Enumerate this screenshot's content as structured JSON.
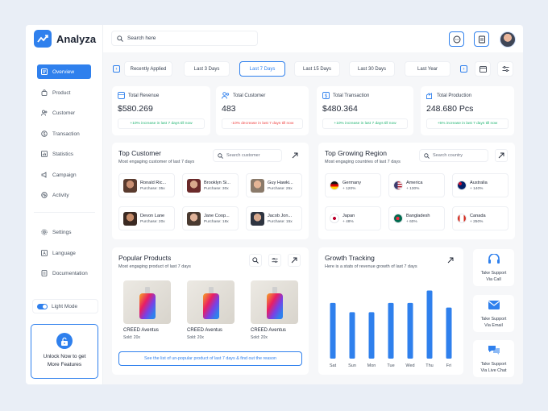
{
  "app": {
    "name": "Analyza"
  },
  "sidebar": {
    "items": [
      {
        "label": "Overview",
        "icon": "overview-icon"
      },
      {
        "label": "Product",
        "icon": "bag-icon"
      },
      {
        "label": "Customer",
        "icon": "users-icon"
      },
      {
        "label": "Transaction",
        "icon": "wallet-icon"
      },
      {
        "label": "Statistics",
        "icon": "chart-icon"
      },
      {
        "label": "Campaign",
        "icon": "megaphone-icon"
      },
      {
        "label": "Activity",
        "icon": "activity-icon"
      }
    ],
    "bottom_items": [
      {
        "label": "Settings",
        "icon": "gear-icon"
      },
      {
        "label": "Language",
        "icon": "language-icon"
      },
      {
        "label": "Documentation",
        "icon": "document-icon"
      }
    ],
    "light_mode": "Light Mode",
    "unlock": {
      "line1": "Unlock Now to get",
      "line2": "More Features"
    }
  },
  "header": {
    "search_placeholder": "Search here"
  },
  "filters": [
    "Recently Applied",
    "Last 3 Days",
    "Last 7 Days",
    "Last 15 Days",
    "Last 30 Days",
    "Last Year"
  ],
  "selected_filter": "Last 7 Days",
  "stats": [
    {
      "label": "Total Revenue",
      "value": "$580.269",
      "note": "+10% increase in last 7 days till now",
      "trend": "up"
    },
    {
      "label": "Total Customer",
      "value": "483",
      "note": "-10% decrease in last 7 days till now",
      "trend": "down"
    },
    {
      "label": "Total Transaction",
      "value": "$480.364",
      "note": "+10% increase in last 7 days till now",
      "trend": "up"
    },
    {
      "label": "Total Production",
      "value": "248.680 Pcs",
      "note": "+5% increase in last 7 days till now",
      "trend": "up"
    }
  ],
  "top_customer": {
    "title": "Top Customer",
    "subtitle": "Most engaging customer of last 7 days",
    "search_placeholder": "Search customer",
    "people": [
      {
        "name": "Ronald Ric...",
        "purchase": "Purchase: 35x"
      },
      {
        "name": "Brooklyn Si...",
        "purchase": "Purchase: 30x"
      },
      {
        "name": "Guy Hawki...",
        "purchase": "Purchase: 25x"
      },
      {
        "name": "Devon Lane",
        "purchase": "Purchase: 20x"
      },
      {
        "name": "Jane Coop...",
        "purchase": "Purchase: 18x"
      },
      {
        "name": "Jacob Jon...",
        "purchase": "Purchase: 15x"
      }
    ]
  },
  "top_region": {
    "title": "Top Growing Region",
    "subtitle": "Most engaging countries of last 7 days",
    "search_placeholder": "Search country",
    "countries": [
      {
        "name": "Germany",
        "growth": "+ 120%"
      },
      {
        "name": "America",
        "growth": "+ 130%"
      },
      {
        "name": "Australia",
        "growth": "+ 140%"
      },
      {
        "name": "Japan",
        "growth": "+ 48%"
      },
      {
        "name": "Bangladesh",
        "growth": "+ 60%"
      },
      {
        "name": "Canada",
        "growth": "+ 250%"
      }
    ]
  },
  "popular_products": {
    "title": "Popular Products",
    "subtitle": "Most engaging product of last 7 days",
    "items": [
      {
        "name": "CREED Aventus",
        "sold": "Sold: 20x"
      },
      {
        "name": "CREED Aventus",
        "sold": "Sold: 20x"
      },
      {
        "name": "CREED Aventus",
        "sold": "Sold: 20x"
      }
    ],
    "link": "See the list of un-popular product of last 7 days & find out the reason"
  },
  "growth": {
    "title": "Growth Tracking",
    "subtitle": "Here is a stats of revenue growth of last 7 days"
  },
  "chart_data": {
    "type": "bar",
    "categories": [
      "Sat",
      "Sun",
      "Mon",
      "Tue",
      "Wed",
      "Thu",
      "Fri"
    ],
    "values": [
      72,
      60,
      60,
      72,
      72,
      88,
      66
    ],
    "ylim": [
      0,
      100
    ],
    "color": "#2f80ed"
  },
  "support": [
    {
      "line1": "Take Support",
      "line2": "Via Call"
    },
    {
      "line1": "Take Support",
      "line2": "Via Email"
    },
    {
      "line1": "Take Support",
      "line2": "Via Live Chat"
    }
  ],
  "colors": {
    "accent": "#2f80ed",
    "up": "#22b573",
    "down": "#ef4444"
  }
}
